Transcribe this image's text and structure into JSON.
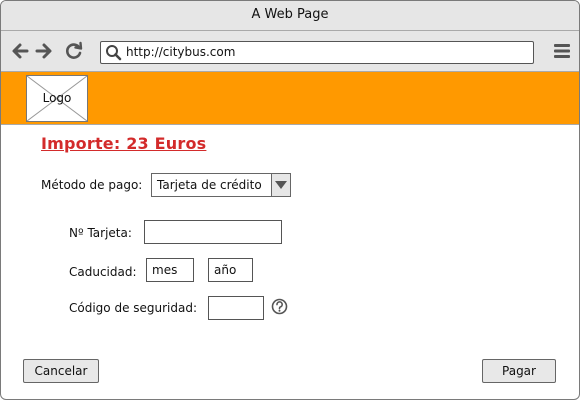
{
  "window": {
    "title": "A Web Page"
  },
  "browser": {
    "url": "http://citybus.com",
    "icons": [
      "arrow-left-icon",
      "arrow-right-icon",
      "refresh-icon",
      "search-icon",
      "hamburger-menu-icon"
    ]
  },
  "header": {
    "banner_color": "#ff9900",
    "logo_label": "Logo"
  },
  "payment": {
    "amount_text": "Importe: 23 Euros",
    "method_label": "Método de pago:",
    "method_value": "Tarjeta de crédito",
    "card_number_label": "Nº Tarjeta:",
    "card_number_value": "",
    "expiry_label": "Caducidad:",
    "expiry_month_value": "mes",
    "expiry_year_value": "año",
    "security_code_label": "Código de seguridad:",
    "security_code_value": "",
    "help_icon": "question-circle-icon"
  },
  "actions": {
    "cancel_label": "Cancelar",
    "pay_label": "Pagar"
  },
  "colors": {
    "accent": "#d32b2b",
    "banner": "#ff9900",
    "chrome": "#e6e6e6"
  }
}
